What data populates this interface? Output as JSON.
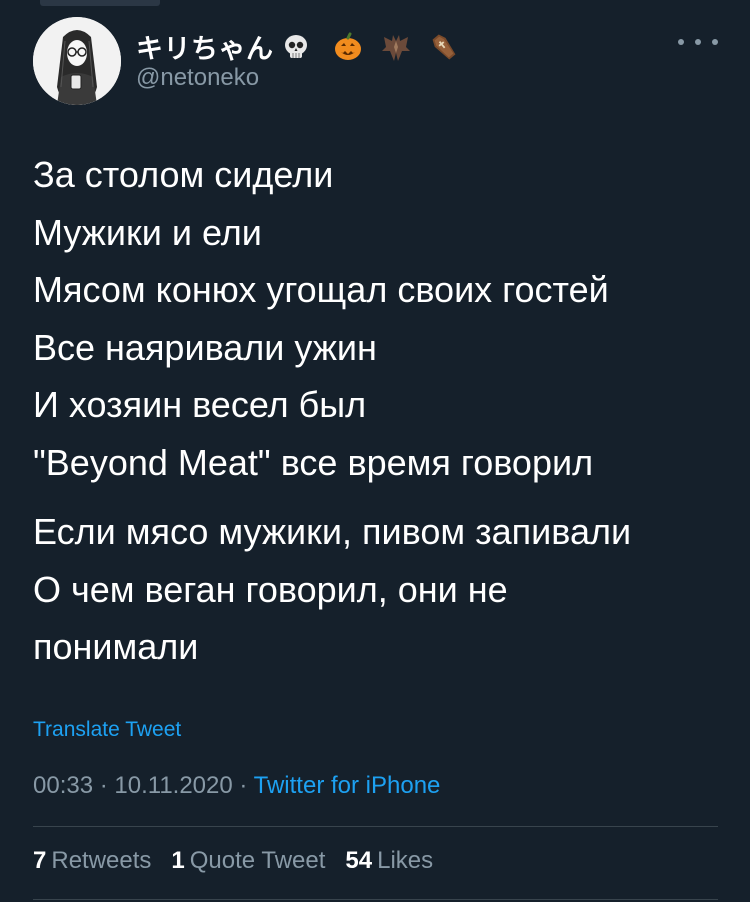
{
  "author": {
    "display_name": "キリちゃん",
    "name_emojis": [
      "skull-emoji",
      "pumpkin-emoji",
      "bat-emoji",
      "coffin-emoji"
    ],
    "handle": "@netoneko"
  },
  "tweet": {
    "stanzas": [
      [
        "За столом сидели",
        "Мужики и ели",
        "Мясом конюх угощал своих гостей",
        "Все наяривали ужин",
        "И хозяин весел был",
        "\"Beyond Meat\" все время говорил"
      ],
      [
        "Если мясо мужики, пивом запивали",
        "О чем веган говорил, они не",
        "понимали"
      ]
    ]
  },
  "translate_label": "Translate Tweet",
  "meta": {
    "time": "00:33",
    "separator": " · ",
    "date": "10.11.2020",
    "source": "Twitter for iPhone"
  },
  "stats": {
    "retweets": {
      "count": "7",
      "label": "Retweets"
    },
    "quotes": {
      "count": "1",
      "label": "Quote Tweet"
    },
    "likes": {
      "count": "54",
      "label": "Likes"
    }
  },
  "colors": {
    "background": "#15202b",
    "text": "#ffffff",
    "muted": "#8899a6",
    "link": "#1da1f2",
    "divider": "#38444d"
  }
}
